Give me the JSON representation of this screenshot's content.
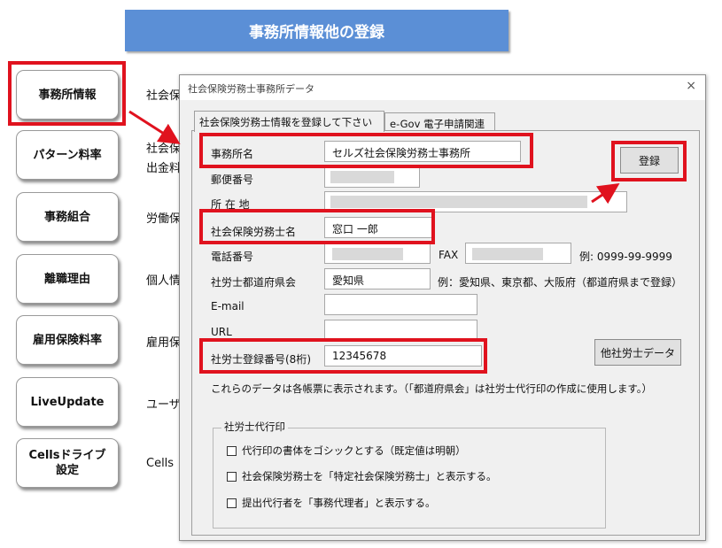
{
  "banner": {
    "title": "事務所情報他の登録"
  },
  "sidebar": {
    "buttons": [
      {
        "label": "事務所情報"
      },
      {
        "label": "パターン料率"
      },
      {
        "label": "事務組合"
      },
      {
        "label": "離職理由"
      },
      {
        "label": "雇用保険料率"
      },
      {
        "label": "LiveUpdate"
      },
      {
        "label": "Cellsドライブ",
        "label2": "設定"
      }
    ],
    "labels": [
      "社会保",
      "社会保",
      "出金料",
      "労働保",
      "個人情",
      "雇用保",
      "ユーザ",
      "Cells"
    ]
  },
  "dialog": {
    "title": "社会保険労務士事務所データ",
    "close": "×",
    "tabs": [
      "社会保険労務士情報を登録して下さい",
      "e-Gov 電子申請関連"
    ],
    "fields": {
      "office_name": {
        "label": "事務所名",
        "value": "セルズ社会保険労務士事務所"
      },
      "postal": {
        "label": "郵便番号"
      },
      "address": {
        "label": "所 在 地"
      },
      "sr_name": {
        "label": "社会保険労務士名",
        "value": "窓口 一郎"
      },
      "phone": {
        "label": "電話番号"
      },
      "fax": {
        "label": "FAX"
      },
      "fax_example": "例:  0999-99-9999",
      "prefecture": {
        "label": "社労士都道府県会",
        "value": "愛知県"
      },
      "pref_example": "例：愛知県、東京都、大阪府（都道府県まで登録）",
      "email": {
        "label": "E-mail"
      },
      "url": {
        "label": "URL"
      },
      "reg_no": {
        "label": "社労士登録番号(8桁)",
        "value": "12345678"
      }
    },
    "note": "これらのデータは各帳票に表示されます。（「都道府県会」は社労士代行印の作成に使用します。）",
    "register_button": "登録",
    "other_sr_button": "他社労士データ",
    "seal_group": {
      "title": "社労士代行印",
      "options": [
        "代行印の書体をゴシックとする（既定値は明朝）",
        "社会保険労務士を「特定社会保険労務士」と表示する。",
        "提出代行者を「事務代理者」と表示する。"
      ]
    }
  },
  "colors": {
    "banner": "#5b8fd6",
    "highlight": "#e0121e",
    "dialog_bg": "#f0f0f0"
  }
}
